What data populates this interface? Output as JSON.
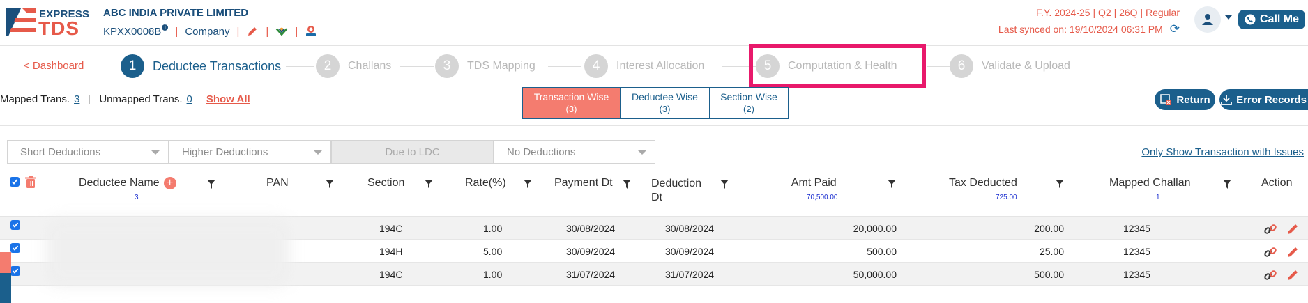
{
  "header": {
    "logo_top": "EXPRESS",
    "logo_bottom": "TDS",
    "company_name": "ABC INDIA PRIVATE LIMITED",
    "tan": "KPXX0008B",
    "entity_type": "Company",
    "fy_info": "F.Y. 2024-25  | Q2  | 26Q | Regular",
    "last_synced": "Last synced on: 19/10/2024 06:31 PM",
    "call_label": "Call Me"
  },
  "stepper": {
    "dashboard": "< Dashboard",
    "steps": [
      {
        "num": "1",
        "label": "Deductee Transactions",
        "active": true
      },
      {
        "num": "2",
        "label": "Challans",
        "active": false
      },
      {
        "num": "3",
        "label": "TDS Mapping",
        "active": false
      },
      {
        "num": "4",
        "label": "Interest Allocation",
        "active": false
      },
      {
        "num": "5",
        "label": "Computation & Health",
        "active": false
      },
      {
        "num": "6",
        "label": "Validate & Upload",
        "active": false
      }
    ]
  },
  "toolbar": {
    "mapped_label": "Mapped Trans.",
    "mapped_count": "3",
    "unmapped_label": "Unmapped Trans.",
    "unmapped_count": "0",
    "show_all": "Show All",
    "tabs": [
      {
        "label": "Transaction Wise",
        "count": "(3)",
        "active": true
      },
      {
        "label": "Deductee Wise",
        "count": "(3)",
        "active": false
      },
      {
        "label": "Section Wise",
        "count": "(2)",
        "active": false
      }
    ],
    "return_label": "Return",
    "error_label": "Error Records"
  },
  "filters": {
    "short": "Short Deductions",
    "higher": "Higher Deductions",
    "ldc": "Due to LDC",
    "none": "No Deductions",
    "issues_link": "Only Show Transaction with Issues"
  },
  "table": {
    "headers": {
      "deductee": "Deductee Name",
      "deductee_count": "3",
      "pan": "PAN",
      "section": "Section",
      "rate": "Rate(%)",
      "payment_dt": "Payment Dt",
      "deduction_dt_1": "Deduction",
      "deduction_dt_2": "Dt",
      "amt_paid": "Amt Paid",
      "amt_paid_total": "70,500.00",
      "tax_deducted": "Tax Deducted",
      "tax_total": "725.00",
      "mapped_challan": "Mapped Challan",
      "challan_count": "1",
      "action": "Action"
    },
    "rows": [
      {
        "section": "194C",
        "rate": "1.00",
        "payment_dt": "30/08/2024",
        "deduction_dt": "30/08/2024",
        "amt_paid": "20,000.00",
        "tax": "200.00",
        "challan": "12345"
      },
      {
        "section": "194H",
        "rate": "5.00",
        "payment_dt": "30/09/2024",
        "deduction_dt": "30/09/2024",
        "amt_paid": "500.00",
        "tax": "25.00",
        "challan": "12345"
      },
      {
        "section": "194C",
        "rate": "1.00",
        "payment_dt": "31/07/2024",
        "deduction_dt": "31/07/2024",
        "amt_paid": "50,000.00",
        "tax": "500.00",
        "challan": "12345"
      }
    ]
  },
  "colors": {
    "primary": "#1b5f8c",
    "accent": "#e65a4a",
    "highlight": "#e8196b",
    "active_tab": "#f47c6f"
  },
  "icons": [
    "info-icon",
    "edit-icon",
    "logo-badge-icon",
    "certificate-icon",
    "refresh-icon",
    "user-icon",
    "phone-icon",
    "return-icon",
    "download-icon",
    "filter-icon",
    "add-icon",
    "delete-icon",
    "link-icon",
    "pencil-icon"
  ]
}
